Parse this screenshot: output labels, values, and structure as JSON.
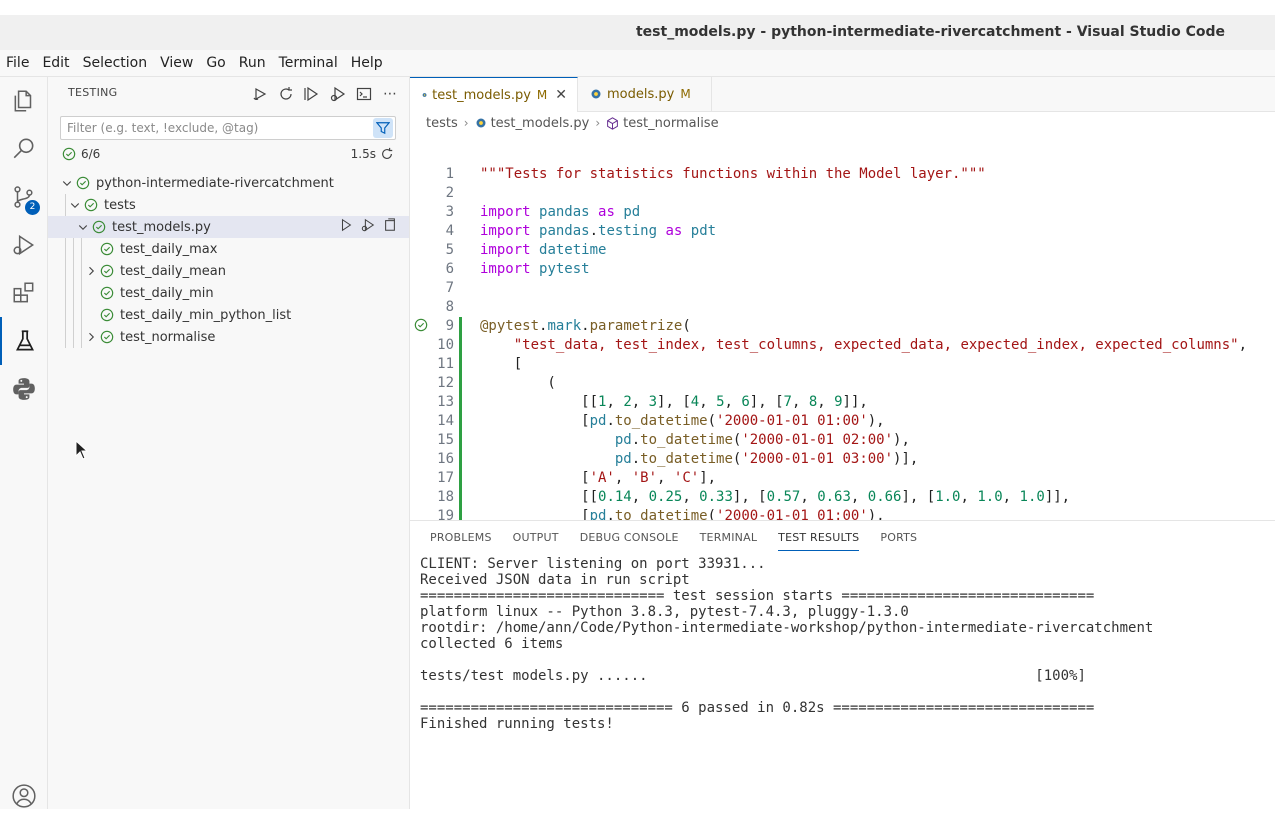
{
  "window": {
    "title": "test_models.py - python-intermediate-rivercatchment - Visual Studio Code"
  },
  "menu": [
    "File",
    "Edit",
    "Selection",
    "View",
    "Go",
    "Run",
    "Terminal",
    "Help"
  ],
  "activity_bar": {
    "items": [
      "files-icon",
      "search-icon",
      "source-control-icon",
      "run-debug-icon",
      "extensions-icon",
      "testing-icon",
      "python-icon"
    ],
    "source_control_badge": "2",
    "accent": "#005fb8"
  },
  "sidebar": {
    "heading": "TESTING",
    "filter_placeholder": "Filter (e.g. text, !exclude, @tag)",
    "summary_count": "6/6",
    "summary_duration": "1.5s",
    "tree": [
      {
        "label": "python-intermediate-rivercatchment",
        "level": 0,
        "expanded": true
      },
      {
        "label": "tests",
        "level": 1,
        "expanded": true
      },
      {
        "label": "test_models.py",
        "level": 2,
        "expanded": true,
        "selected": true
      },
      {
        "label": "test_daily_max",
        "level": 3,
        "expanded": false
      },
      {
        "label": "test_daily_mean",
        "level": 3,
        "expanded": false
      },
      {
        "label": "test_daily_min",
        "level": 3,
        "expanded": false
      },
      {
        "label": "test_daily_min_python_list",
        "level": 3,
        "expanded": false
      },
      {
        "label": "test_normalise",
        "level": 3,
        "expanded": false
      }
    ],
    "pass_color": "#388a34"
  },
  "editor": {
    "tabs": [
      {
        "name": "test_models.py",
        "badge": "M",
        "active": true
      },
      {
        "name": "models.py",
        "badge": "M",
        "active": false
      }
    ],
    "breadcrumb": [
      "tests",
      "test_models.py",
      "test_normalise"
    ],
    "lines": [
      "\"\"\"Tests for statistics functions within the Model layer.\"\"\"",
      "",
      "import pandas as pd",
      "import pandas.testing as pdt",
      "import datetime",
      "import pytest",
      "",
      "",
      "@pytest.mark.parametrize(",
      "    \"test_data, test_index, test_columns, expected_data, expected_index, expected_columns\",",
      "    [",
      "        (",
      "            [[1, 2, 3], [4, 5, 6], [7, 8, 9]],",
      "            [pd.to_datetime('2000-01-01 01:00'),",
      "                pd.to_datetime('2000-01-01 02:00'),",
      "                pd.to_datetime('2000-01-01 03:00')],",
      "            ['A', 'B', 'C'],",
      "            [[0.14, 0.25, 0.33], [0.57, 0.63, 0.66], [1.0, 1.0, 1.0]],",
      "            [pd.to_datetime('2000-01-01 01:00'),"
    ]
  },
  "panel": {
    "tabs": [
      "PROBLEMS",
      "OUTPUT",
      "DEBUG CONSOLE",
      "TERMINAL",
      "TEST RESULTS",
      "PORTS"
    ],
    "active_tab": "TEST RESULTS",
    "output_lines": [
      "CLIENT: Server listening on port 33931...",
      "Received JSON data in run script",
      "============================= test session starts ==============================",
      "platform linux -- Python 3.8.3, pytest-7.4.3, pluggy-1.3.0",
      "rootdir: /home/ann/Code/Python-intermediate-workshop/python-intermediate-rivercatchment",
      "collected 6 items",
      "",
      "tests/test models.py ......                                              [100%]",
      "",
      "============================== 6 passed in 0.82s ===============================",
      "Finished running tests!"
    ]
  }
}
